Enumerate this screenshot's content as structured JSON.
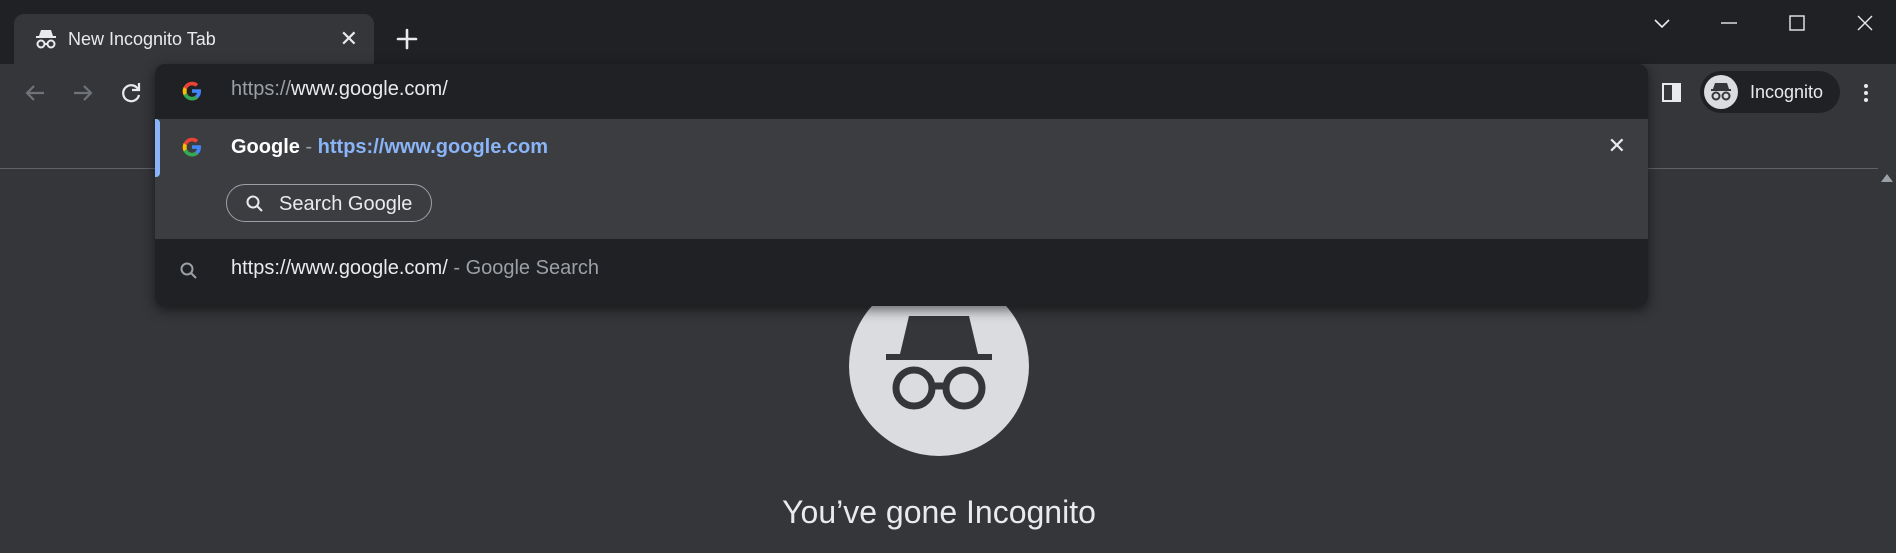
{
  "tab": {
    "title": "New Incognito Tab",
    "close": "✕",
    "new_tab": "+"
  },
  "window_controls": [
    "tab-search",
    "minimize",
    "maximize",
    "close"
  ],
  "toolbar": {
    "back": "back",
    "forward": "forward",
    "reload": "reload",
    "profile_label": "Incognito"
  },
  "omnibox": {
    "input_scheme": "https://",
    "input_rest": "www.google.com/",
    "suggestions": [
      {
        "title": "Google",
        "separator": " - ",
        "url": "https://www.google.com",
        "remove": "✕",
        "action_chip": "Search Google"
      },
      {
        "query": "https://www.google.com/",
        "separator": " - ",
        "description": "Google Search"
      }
    ]
  },
  "page": {
    "heading": "You’ve gone Incognito"
  },
  "colors": {
    "accent": "#8ab4f8",
    "background": "#35363a",
    "frame": "#202124"
  }
}
